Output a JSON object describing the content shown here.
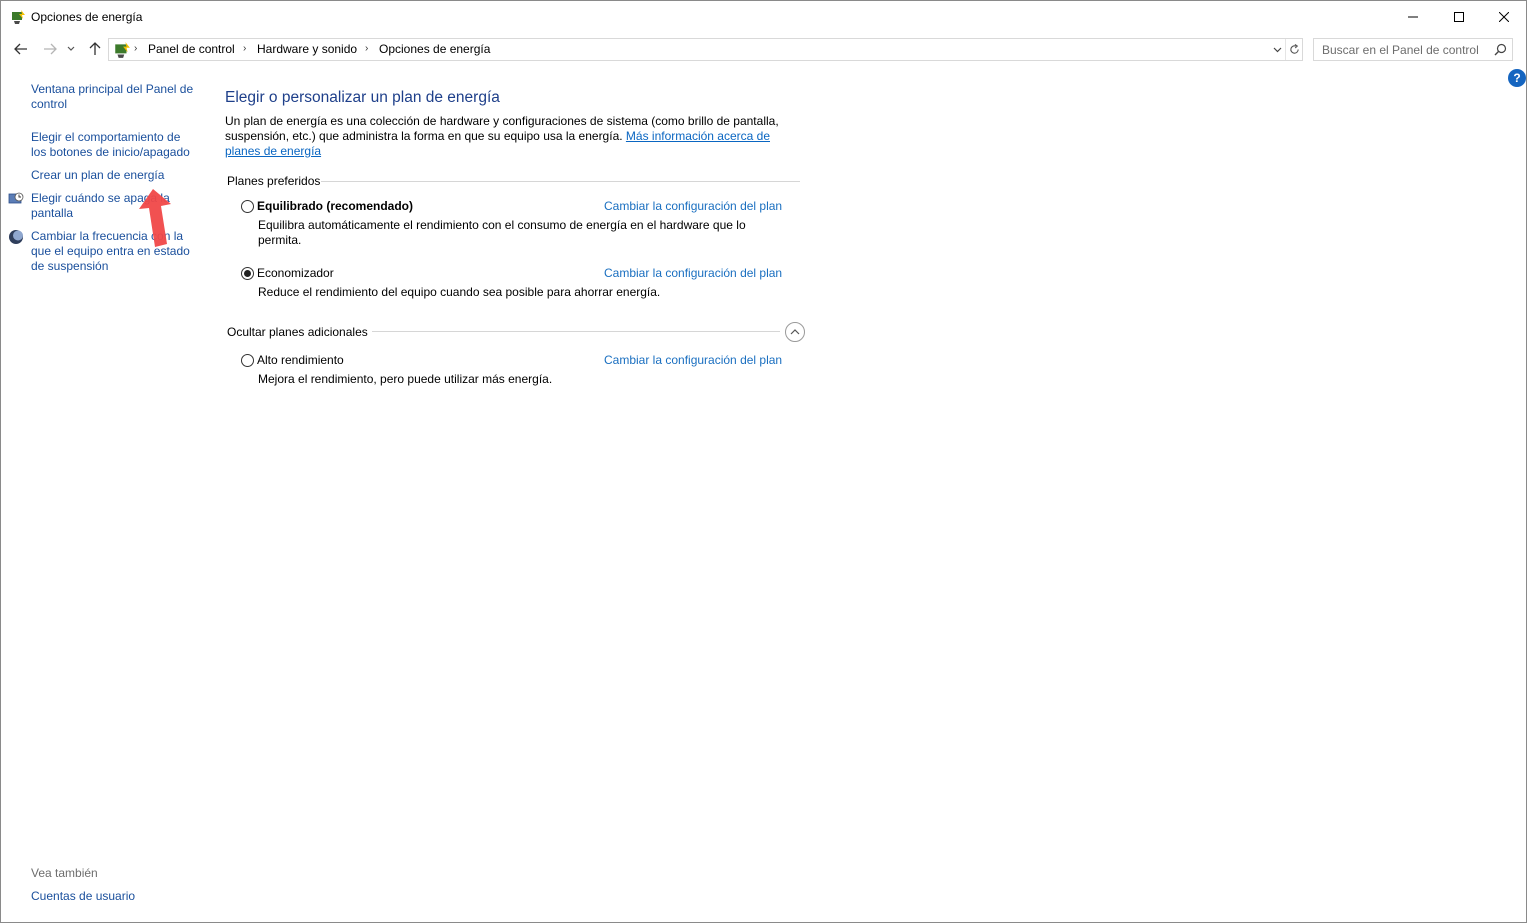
{
  "window": {
    "title": "Opciones de energía"
  },
  "breadcrumb": [
    "Panel de control",
    "Hardware y sonido",
    "Opciones de energía"
  ],
  "search": {
    "placeholder": "Buscar en el Panel de control"
  },
  "sidebar": {
    "links": [
      {
        "label": "Ventana principal del Panel de\ncontrol"
      },
      {
        "label": "Elegir el comportamiento de\nlos botones de inicio/apagado"
      },
      {
        "label": "Crear un plan de energía"
      },
      {
        "label": "Elegir cuándo se apaga la\npantalla"
      },
      {
        "label": "Cambiar la frecuencia con la\nque el equipo entra en estado\nde suspensión"
      }
    ],
    "see_also_label": "Vea también",
    "see_also_links": [
      {
        "label": "Cuentas de usuario"
      }
    ]
  },
  "main": {
    "title": "Elegir o personalizar un plan de energía",
    "description": "Un plan de energía es una colección de hardware y configuraciones de sistema (como brillo de pantalla, suspensión, etc.) que administra la forma en que su equipo usa la energía.",
    "more_info_link": "Más información acerca de planes de energía",
    "preferred_label": "Planes preferidos",
    "additional_label": "Ocultar planes adicionales",
    "plans": [
      {
        "name": "Equilibrado (recomendado)",
        "selected": false,
        "description": "Equilibra automáticamente el rendimiento con el consumo de energía en el hardware que lo permita.",
        "link": "Cambiar la configuración del plan"
      },
      {
        "name": "Economizador",
        "selected": true,
        "description": "Reduce el rendimiento del equipo cuando sea posible para ahorrar energía.",
        "link": "Cambiar la configuración del plan"
      },
      {
        "name": "Alto rendimiento",
        "selected": false,
        "description": "Mejora el rendimiento, pero puede utilizar más energía.",
        "link": "Cambiar la configuración del plan"
      }
    ]
  },
  "colors": {
    "link": "#1a4f9c",
    "title": "#1e3f8a",
    "annotation_arrow": "#f04848"
  }
}
